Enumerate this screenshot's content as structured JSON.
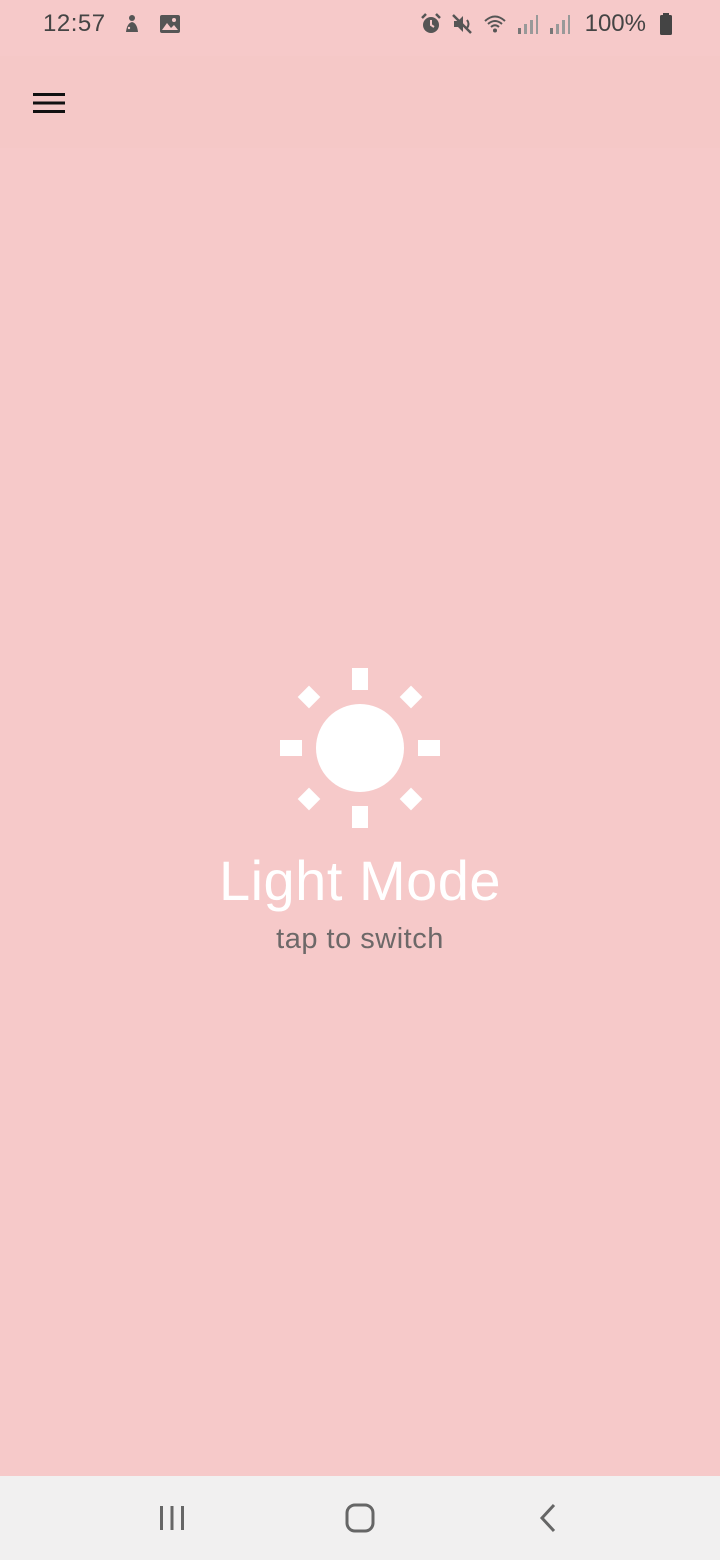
{
  "status_bar": {
    "time": "12:57",
    "battery_percent": "100%",
    "left_icons": [
      "notification-figure-icon",
      "gallery-icon"
    ],
    "right_icons": [
      "alarm-icon",
      "mute-icon",
      "wifi-icon",
      "signal-icon",
      "signal-icon",
      "battery-icon"
    ]
  },
  "app_bar": {
    "menu_icon": "hamburger-menu-icon"
  },
  "main": {
    "icon": "sun-icon",
    "title": "Light Mode",
    "hint": "tap to switch"
  },
  "nav_bar": {
    "buttons": [
      "recents",
      "home",
      "back"
    ]
  },
  "colors": {
    "background": "#f6c9c9",
    "app_bar": "#f5c8c7",
    "title": "#ffffff",
    "hint": "#6d6868",
    "nav_bar": "#f1f0f0"
  }
}
